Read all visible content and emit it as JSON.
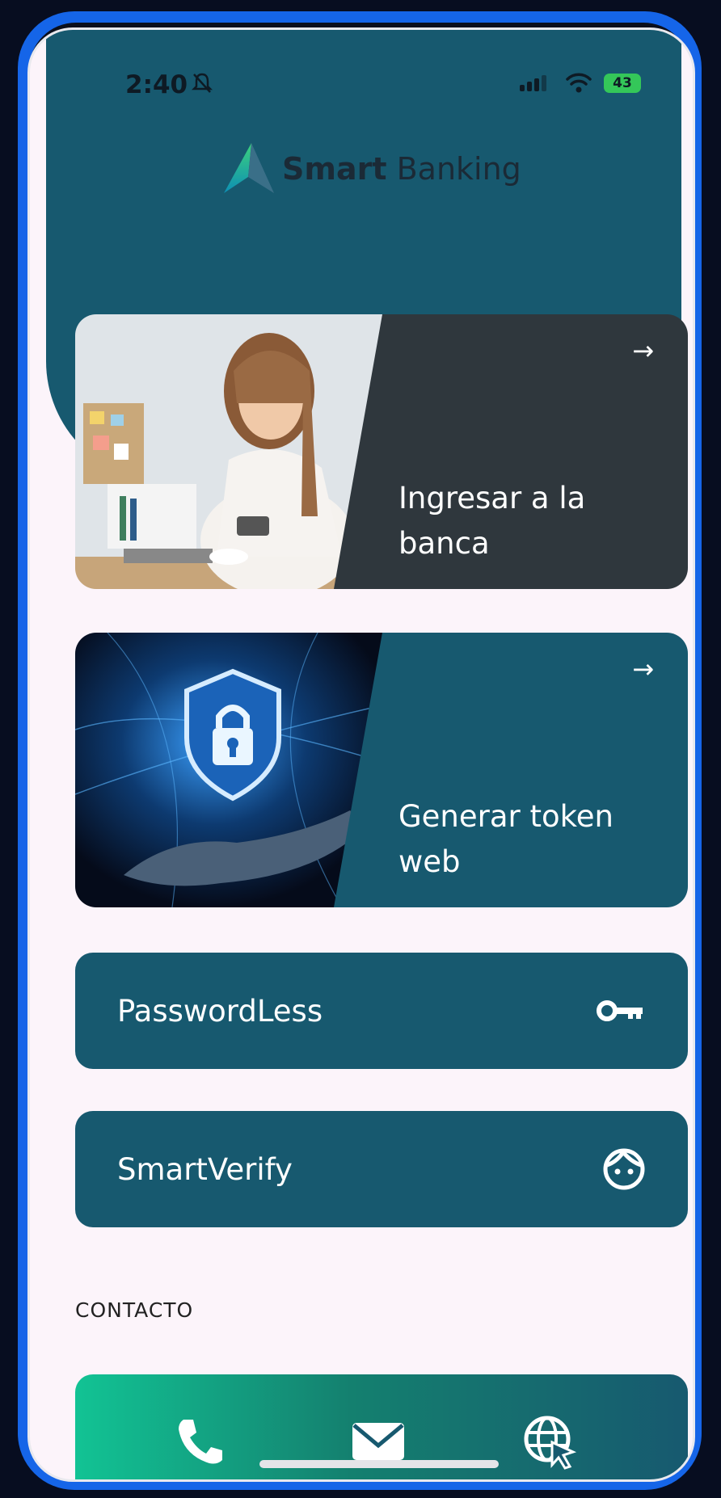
{
  "status_bar": {
    "time": "2:40",
    "battery": "43"
  },
  "brand": {
    "bold": "Smart",
    "light": " Banking"
  },
  "cards": [
    {
      "title": "Ingresar a la banca",
      "arrow": "→"
    },
    {
      "title": "Generar token web",
      "arrow": "→"
    }
  ],
  "buttons": [
    {
      "label": "PasswordLess",
      "icon": "key-icon"
    },
    {
      "label": "SmartVerify",
      "icon": "face-icon"
    }
  ],
  "contact": {
    "label": "CONTACTO",
    "icons": [
      "phone-icon",
      "mail-icon",
      "web-icon"
    ]
  },
  "colors": {
    "primary": "#17596f",
    "dark_card": "#2f373d",
    "contact_gradient_start": "#12c394",
    "frame": "#1565e8"
  }
}
